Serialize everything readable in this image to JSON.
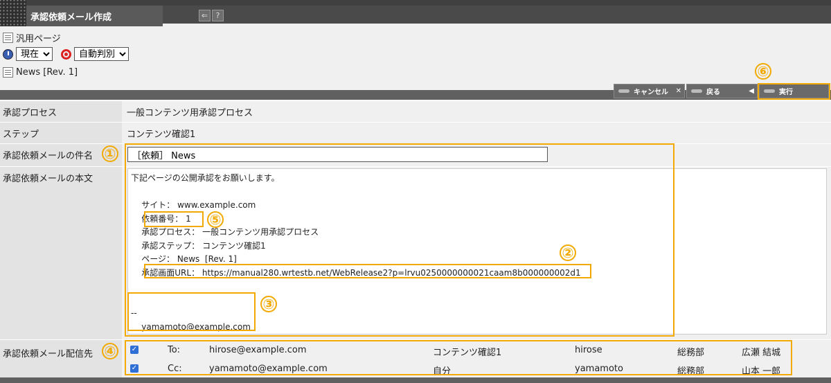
{
  "window": {
    "title": "承認依頼メール作成",
    "back_icon": "back-icon",
    "help_label": "?"
  },
  "page": {
    "type_label": "汎用ページ",
    "time_select": "現在",
    "judge_select": "自動判別",
    "page_name": "News [Rev. 1]"
  },
  "actions": {
    "cancel": "キャンセル",
    "back": "戻る",
    "execute": "実行",
    "cancel_suffix": "✕",
    "back_suffix": "◀"
  },
  "form": {
    "process_label": "承認プロセス",
    "process_value": "一般コンテンツ用承認プロセス",
    "step_label": "ステップ",
    "step_value": "コンテンツ確認1",
    "subject_label": "承認依頼メールの件名",
    "subject_value": "［依頼］ News",
    "body_label": "承認依頼メールの本文",
    "body_lines": [
      "下記ページの公開承認をお願いします。",
      "",
      "    サイト： www.example.com",
      "    依頼番号： 1",
      "    承認プロセス： 一般コンテンツ用承認プロセス",
      "    承認ステップ： コンテンツ確認1",
      "    ページ： News  [Rev. 1]",
      "    承認画面URL： https://manual280.wrtestb.net/WebRelease2?p=lrvu0250000000021caam8b000000002d1",
      "",
      "",
      "--",
      "    yamamoto@example.com"
    ],
    "recipients_label": "承認依頼メール配信先",
    "recipients": [
      {
        "type": "To:",
        "email": "hirose@example.com",
        "role": "コンテンツ確認1",
        "user": "hirose",
        "dept": "総務部",
        "name": "広瀬 結城"
      },
      {
        "type": "Cc:",
        "email": "yamamoto@example.com",
        "role": "自分",
        "user": "yamamoto",
        "dept": "総務部",
        "name": "山本 一郎"
      }
    ]
  },
  "annotations": [
    "①",
    "②",
    "③",
    "④",
    "⑤",
    "⑥"
  ],
  "colors": {
    "annotation": "#f2a900",
    "header": "#4a4a4a",
    "checkbox": "#2f6fd6"
  }
}
